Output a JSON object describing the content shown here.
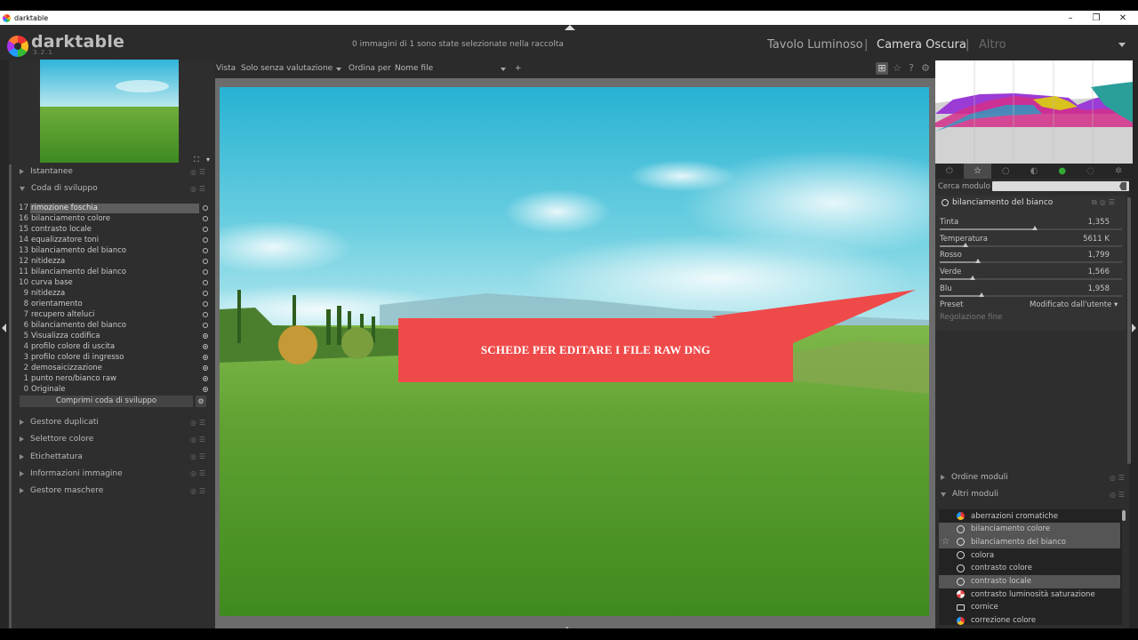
{
  "window": {
    "title": "darktable",
    "controls": [
      "–",
      "❐",
      "✕"
    ]
  },
  "header": {
    "logo_text": "darktable",
    "version": "3.2.1",
    "selection_status": "0 immagini di 1 sono state selezionate nella raccolta",
    "views": [
      "Tavolo Luminoso",
      "|",
      "Camera Oscura",
      "|",
      "Altro"
    ]
  },
  "left": {
    "sections_top": [
      "Istantanee",
      "Coda di sviluppo"
    ],
    "history": [
      {
        "num": "17",
        "label": "rimozione foschia",
        "selected": true,
        "on": false
      },
      {
        "num": "16",
        "label": "bilanciamento colore",
        "on": false
      },
      {
        "num": "15",
        "label": "contrasto locale",
        "on": false
      },
      {
        "num": "14",
        "label": "equalizzatore toni",
        "on": false
      },
      {
        "num": "13",
        "label": "bilanciamento del bianco",
        "on": false
      },
      {
        "num": "12",
        "label": "nitidezza",
        "on": false
      },
      {
        "num": "11",
        "label": "bilanciamento del bianco",
        "on": false
      },
      {
        "num": "10",
        "label": "curva base",
        "on": false
      },
      {
        "num": "9",
        "label": "nitidezza",
        "on": false
      },
      {
        "num": "8",
        "label": "orientamento",
        "on": false
      },
      {
        "num": "7",
        "label": "recupero alteluci",
        "on": false
      },
      {
        "num": "6",
        "label": "bilanciamento del bianco",
        "on": false
      },
      {
        "num": "5",
        "label": "Visualizza codifica",
        "on": true
      },
      {
        "num": "4",
        "label": "profilo colore di uscita",
        "on": true
      },
      {
        "num": "3",
        "label": "profilo colore di ingresso",
        "on": true
      },
      {
        "num": "2",
        "label": "demosaicizzazione",
        "on": true
      },
      {
        "num": "1",
        "label": "punto nero/bianco raw",
        "on": true
      },
      {
        "num": "0",
        "label": "Originale",
        "on": true
      }
    ],
    "compress_label": "Comprimi coda di sviluppo",
    "sections_bottom": [
      "Gestore duplicati",
      "Selettore colore",
      "Etichettatura",
      "Informazioni immagine",
      "Gestore maschere"
    ]
  },
  "toolbar": {
    "view_label": "Vista",
    "filter_value": "Solo senza valutazione",
    "sort_label": "Ordina per",
    "sort_value": "Nome file",
    "plus": "+"
  },
  "callout": {
    "text": "SCHEDE PER EDITARE I FILE RAW DNG"
  },
  "right": {
    "search_label": "Cerca modulo",
    "module_title": "bilanciamento del bianco",
    "sliders": [
      {
        "label": "Tinta",
        "value": "1,355",
        "fraction": 0.52
      },
      {
        "label": "Temperatura",
        "value": "5611 K",
        "fraction": 0.14
      },
      {
        "label": "Rosso",
        "value": "1,799",
        "fraction": 0.21
      },
      {
        "label": "Verde",
        "value": "1,566",
        "fraction": 0.18
      },
      {
        "label": "Blu",
        "value": "1,958",
        "fraction": 0.23
      }
    ],
    "preset_label": "Preset",
    "preset_value": "Modificato dall'utente",
    "fine_label": "Regolazione fine",
    "sections": [
      "Ordine moduli",
      "Altri moduli"
    ],
    "modules": [
      {
        "label": "aberrazioni cromatiche",
        "hl": false,
        "icon": "color"
      },
      {
        "label": "bilanciamento colore",
        "hl": true,
        "icon": "ring"
      },
      {
        "label": "bilanciamento del bianco",
        "hl": true,
        "icon": "ring",
        "star": true
      },
      {
        "label": "colora",
        "hl": false,
        "icon": "ring"
      },
      {
        "label": "contrasto colore",
        "hl": false,
        "icon": "ring"
      },
      {
        "label": "contrasto locale",
        "hl": true,
        "icon": "ring"
      },
      {
        "label": "contrasto luminosità saturazione",
        "hl": false,
        "icon": "pie"
      },
      {
        "label": "cornice",
        "hl": false,
        "icon": "square"
      },
      {
        "label": "correzione colore",
        "hl": false,
        "icon": "color"
      }
    ]
  },
  "colors": {
    "callout": "#ef4a4a",
    "panel": "#2e2e2e",
    "highlight": "#555555"
  }
}
